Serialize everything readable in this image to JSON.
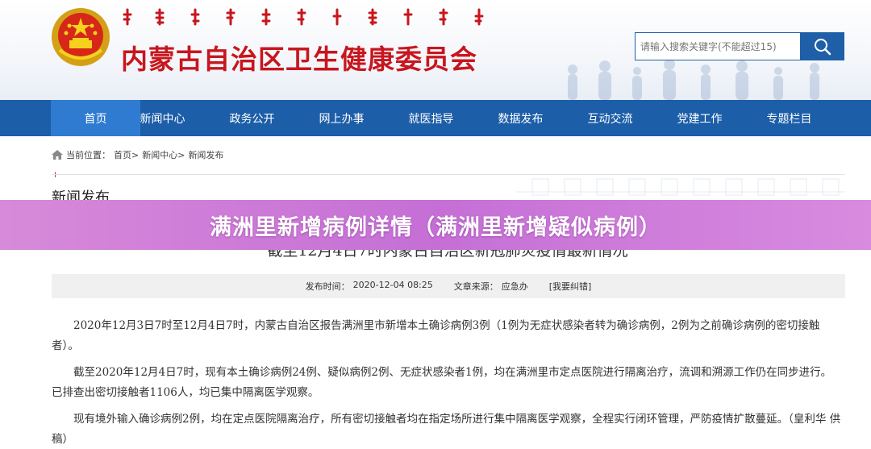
{
  "header": {
    "site_title": "内蒙古自治区卫生健康委员会",
    "colors": {
      "title_red": "#c8161e",
      "nav_blue": "#1c5ea8",
      "nav_active": "#2f7bd1"
    },
    "emblem_icon": "national-emblem",
    "search": {
      "placeholder": "请输入搜索关键字(不能超过15)",
      "icon": "search-icon"
    }
  },
  "nav": {
    "items": [
      "首页",
      "新闻中心",
      "政务公开",
      "网上办事",
      "就医指导",
      "数据发布",
      "互动交流",
      "党建工作",
      "专题栏目"
    ],
    "active_index": 0
  },
  "breadcrumb": {
    "prefix": "当前位置：",
    "crumbs": [
      "首页>",
      "新闻中心>",
      "新闻发布"
    ]
  },
  "section": {
    "title": "新闻发布"
  },
  "banner": {
    "text": "满洲里新增病例详情（满洲里新增疑似病例）"
  },
  "article": {
    "title": "截至12月4日7时内蒙古自治区新冠肺炎疫情最新情况",
    "meta": {
      "publish_label": "发布时间：",
      "publish_time": "2020-12-04 08:25",
      "source_label": "文章来源：",
      "source": "应急办",
      "correction": "[我要纠错]"
    },
    "paragraphs": [
      "2020年12月3日7时至12月4日7时，内蒙古自治区报告满洲里市新增本土确诊病例3例（1例为无症状感染者转为确诊病例，2例为之前确诊病例的密切接触者）。",
      "截至2020年12月4日7时，现有本土确诊病例24例、疑似病例2例、无症状感染者1例，均在满洲里市定点医院进行隔离治疗，流调和溯源工作仍在同步进行。已排查出密切接触者1106人，均已集中隔离医学观察。",
      "现有境外输入确诊病例2例，均在定点医院隔离治疗，所有密切接触者均在指定场所进行集中隔离医学观察，全程实行闭环管理，严防疫情扩散蔓延。（皇利华  供稿）"
    ]
  }
}
